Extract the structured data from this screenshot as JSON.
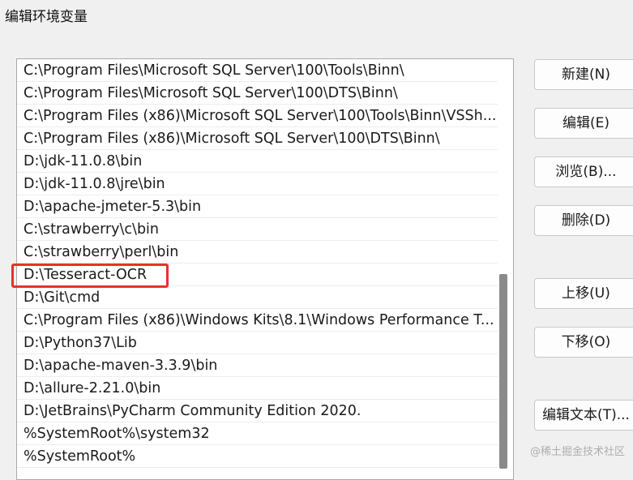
{
  "window": {
    "title": "编辑环境变量"
  },
  "path_list": {
    "items": [
      {
        "label": "C:\\Program Files\\Microsoft SQL Server\\100\\Tools\\Binn\\"
      },
      {
        "label": "C:\\Program Files\\Microsoft SQL Server\\100\\DTS\\Binn\\"
      },
      {
        "label": "C:\\Program Files (x86)\\Microsoft SQL Server\\100\\Tools\\Binn\\VSSh..."
      },
      {
        "label": "C:\\Program Files (x86)\\Microsoft SQL Server\\100\\DTS\\Binn\\"
      },
      {
        "label": "D:\\jdk-11.0.8\\bin"
      },
      {
        "label": "D:\\jdk-11.0.8\\jre\\bin"
      },
      {
        "label": "D:\\apache-jmeter-5.3\\bin"
      },
      {
        "label": "C:\\strawberry\\c\\bin"
      },
      {
        "label": "C:\\strawberry\\perl\\bin"
      },
      {
        "label": "D:\\Tesseract-OCR"
      },
      {
        "label": "D:\\Git\\cmd"
      },
      {
        "label": "C:\\Program Files (x86)\\Windows Kits\\8.1\\Windows Performance T..."
      },
      {
        "label": "D:\\Python37\\Lib"
      },
      {
        "label": "D:\\apache-maven-3.3.9\\bin"
      },
      {
        "label": "D:\\allure-2.21.0\\bin"
      },
      {
        "label": "D:\\JetBrains\\PyCharm Community Edition 2020."
      },
      {
        "label": "%SystemRoot%\\system32"
      },
      {
        "label": "%SystemRoot%"
      }
    ],
    "highlighted_item": "D:\\Tesseract-OCR"
  },
  "buttons": {
    "new": "新建(N)",
    "edit": "编辑(E)",
    "browse": "浏览(B)...",
    "delete": "删除(D)",
    "move_up": "上移(U)",
    "move_down": "下移(O)",
    "edit_text": "编辑文本(T)..."
  },
  "watermark": "@稀土掘金技术社区",
  "colors": {
    "highlight": "#e8312b",
    "background": "#f0f0f0",
    "list_background": "#ffffff"
  }
}
